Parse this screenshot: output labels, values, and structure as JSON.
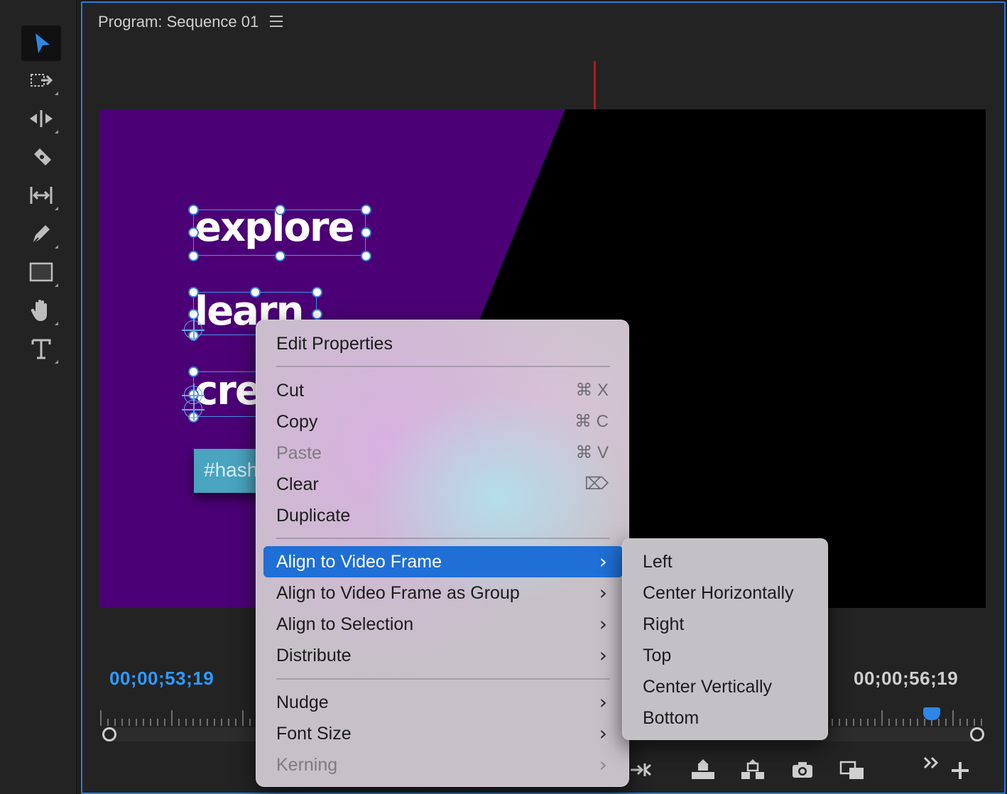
{
  "panel": {
    "title": "Program: Sequence 01",
    "menu_icon": "hamburger-icon"
  },
  "tools": [
    {
      "name": "selection-tool",
      "icon": "arrow-icon",
      "active": true
    },
    {
      "name": "track-select-tool",
      "icon": "track-select-icon"
    },
    {
      "name": "ripple-edit-tool",
      "icon": "ripple-edit-icon"
    },
    {
      "name": "razor-tool",
      "icon": "razor-icon"
    },
    {
      "name": "slip-tool",
      "icon": "slip-icon"
    },
    {
      "name": "pen-tool",
      "icon": "pen-icon"
    },
    {
      "name": "rectangle-tool",
      "icon": "rectangle-icon"
    },
    {
      "name": "hand-tool",
      "icon": "hand-icon"
    },
    {
      "name": "type-tool",
      "icon": "type-icon"
    }
  ],
  "video": {
    "line1": "explore",
    "line2": "learn",
    "line3": "cre",
    "hashtag": "#hash",
    "purple": "#4b0075",
    "accent": "#4aa3bf"
  },
  "timecode": {
    "current": "00;00;53;19",
    "duration": "00;00;56;19"
  },
  "context_menu": {
    "edit_properties": "Edit Properties",
    "cut": {
      "label": "Cut",
      "shortcut": "⌘ X"
    },
    "copy": {
      "label": "Copy",
      "shortcut": "⌘ C"
    },
    "paste": {
      "label": "Paste",
      "shortcut": "⌘ V"
    },
    "clear": {
      "label": "Clear",
      "shortcut": "⌦"
    },
    "duplicate": "Duplicate",
    "align_video_frame": "Align to Video Frame",
    "align_video_frame_group": "Align to Video Frame as Group",
    "align_selection": "Align to Selection",
    "distribute": "Distribute",
    "nudge": "Nudge",
    "font_size": "Font Size",
    "kerning": "Kerning"
  },
  "submenu": [
    "Left",
    "Center Horizontally",
    "Right",
    "Top",
    "Center Vertically",
    "Bottom"
  ],
  "transport": [
    "insert-icon",
    "lift-icon",
    "extract-icon",
    "camera-icon",
    "comparison-view-icon",
    "more-icon",
    "add-icon"
  ],
  "highlight_color": "#1f6fd6",
  "timecode_color": "#2e9bff"
}
